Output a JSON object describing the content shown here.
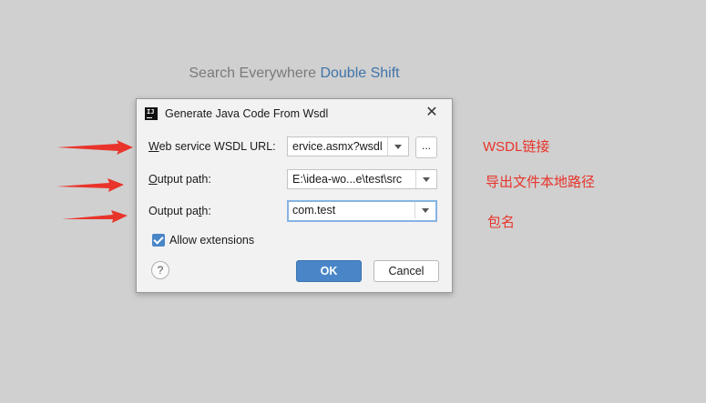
{
  "background_hint": {
    "text": "Search Everywhere",
    "shortcut": "Double Shift"
  },
  "dialog": {
    "title": "Generate Java Code From Wsdl",
    "fields": [
      {
        "label_mnemonic": "W",
        "label_rest": "eb service WSDL URL:",
        "value": "ervice.asmx?wsdl"
      },
      {
        "label_mnemonic": "O",
        "label_rest": "utput path:",
        "value": "E:\\idea-wo...e\\test\\src"
      },
      {
        "label_prefix": "Output pa",
        "label_mnemonic": "t",
        "label_rest": "h:",
        "value": "com.test"
      }
    ],
    "browse_label": "...",
    "checkbox": {
      "label": "Allow extensions",
      "checked": true
    },
    "help_label": "?",
    "ok_label": "OK",
    "cancel_label": "Cancel"
  },
  "annotations": [
    {
      "text": "WSDL链接"
    },
    {
      "text": "导出文件本地路径"
    },
    {
      "text": "包名"
    }
  ],
  "colors": {
    "accent": "#4a86c7",
    "annotation": "#e8342b",
    "background": "#d0d0d0"
  }
}
